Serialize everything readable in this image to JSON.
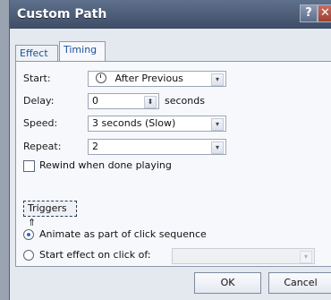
{
  "dialog": {
    "title": "Custom Path",
    "help_label": "?",
    "close_label": "✕"
  },
  "tabs": [
    {
      "label": "Effect"
    },
    {
      "label": "Timing"
    }
  ],
  "timing": {
    "start_label": "Start:",
    "start_value": "After Previous",
    "delay_label": "Delay:",
    "delay_value": "0",
    "delay_unit": "seconds",
    "speed_label": "Speed:",
    "speed_value": "3 seconds (Slow)",
    "repeat_label": "Repeat:",
    "repeat_value": "2",
    "rewind_label": "Rewind when done playing",
    "triggers_label": "Triggers",
    "triggers_arrow": "⇑",
    "animate_label": "Animate as part of click sequence",
    "start_effect_label": "Start effect on click of:"
  },
  "buttons": {
    "ok": "OK",
    "cancel": "Cancel"
  },
  "icons": {
    "dropdown": "▾",
    "spinner": "⬍"
  }
}
